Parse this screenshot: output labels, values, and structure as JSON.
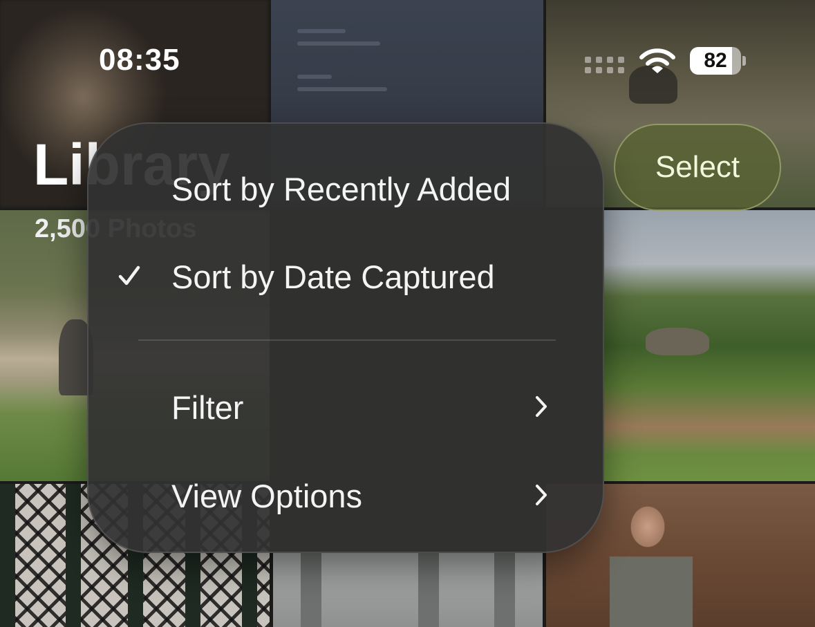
{
  "status_bar": {
    "time": "08:35",
    "battery_level": "82",
    "icons": [
      "cellular-signal-icon",
      "wifi-icon",
      "battery-icon"
    ]
  },
  "header": {
    "title": "Library",
    "count": "2,500 Photos",
    "select_label": "Select"
  },
  "menu": {
    "items": [
      {
        "label": "Sort by Recently Added",
        "checked": false
      },
      {
        "label": "Sort by Date Captured",
        "checked": true,
        "icon": "checkmark-icon"
      },
      {
        "label": "Filter",
        "icon": "chevron-right-icon"
      },
      {
        "label": "View Options",
        "icon": "chevron-right-icon"
      }
    ]
  },
  "colors": {
    "menu_background": "#323232",
    "select_button": "#586232",
    "text": "#f4f4f4"
  }
}
